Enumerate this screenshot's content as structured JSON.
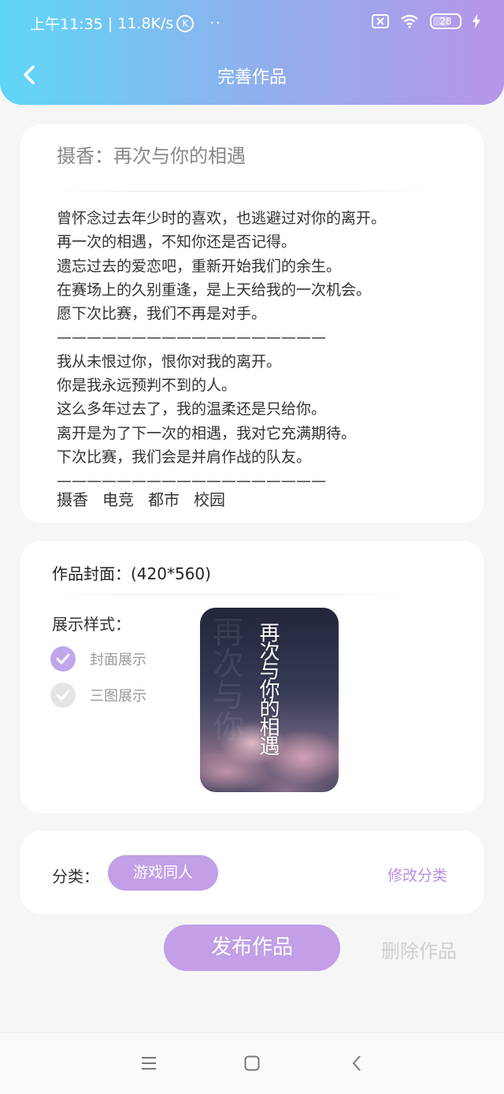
{
  "status_bar": {
    "time": "上午11:35",
    "speed": "11.8K/s",
    "k_badge": "K",
    "dots": "··",
    "battery": "28"
  },
  "header": {
    "title": "完善作品",
    "back_icon": "chevron-left-icon"
  },
  "work": {
    "title": "摄香：再次与你的相遇",
    "description_lines": [
      "曾怀念过去年少时的喜欢，也逃避过对你的离开。",
      "再一次的相遇，不知你还是否记得。",
      "遗忘过去的爱恋吧，重新开始我们的余生。",
      "在赛场上的久别重逢，是上天给我的一次机会。",
      "愿下次比赛，我们不再是对手。",
      "——————————————————",
      "我从未恨过你，恨你对我的离开。",
      "你是我永远预判不到的人。",
      "这么多年过去了，我的温柔还是只给你。",
      "离开是为了下一次的相遇，我对它充满期待。",
      "下次比赛，我们会是并肩作战的队友。",
      "——————————————————"
    ],
    "tags": [
      "摄香",
      "电竞",
      "都市",
      "校园"
    ]
  },
  "cover_section": {
    "label": "作品封面：(420*560)",
    "style_label": "展示样式：",
    "options": [
      {
        "label": "封面展示",
        "checked": true
      },
      {
        "label": "三图展示",
        "checked": false
      }
    ],
    "cover_text": "再次与你的相遇",
    "cover_bg_text": "再次与你"
  },
  "category": {
    "label": "分类：",
    "value": "游戏同人",
    "edit_label": "修改分类"
  },
  "actions": {
    "publish_label": "发布作品",
    "delete_label": "删除作品"
  },
  "colors": {
    "accent": "#c29fe6",
    "header_start": "#5ed6f6",
    "header_end": "#b795e8"
  }
}
